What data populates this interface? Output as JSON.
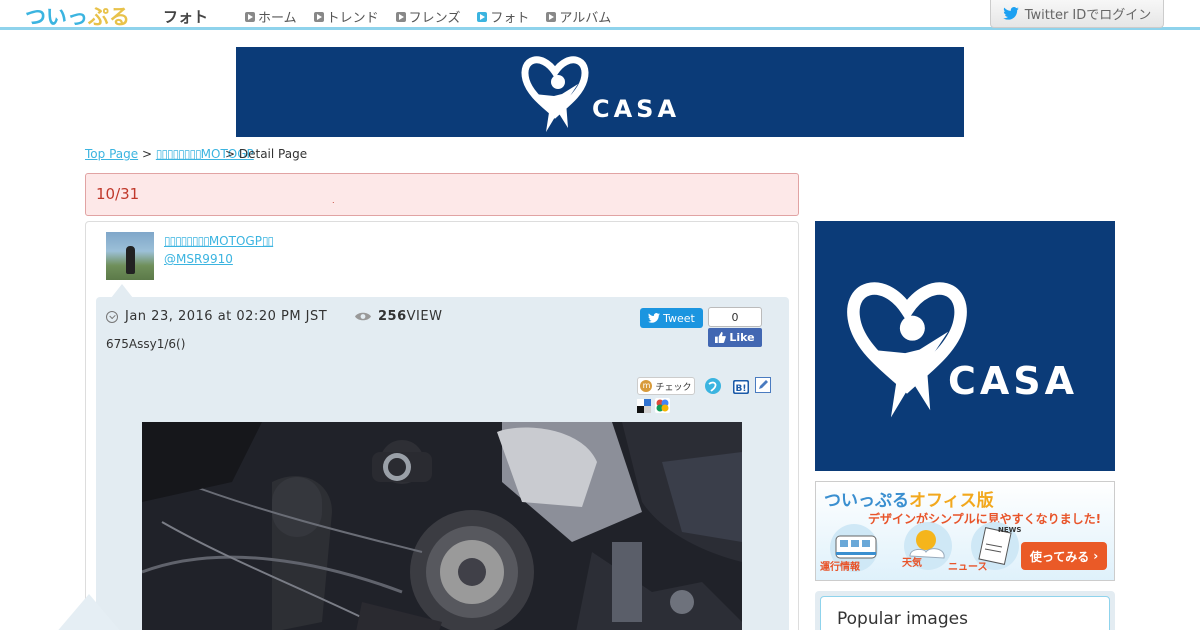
{
  "header": {
    "logo_part1": "ついっ",
    "logo_part2": "ぷる",
    "section_title": "フォト",
    "nav": [
      {
        "label": "ホーム"
      },
      {
        "label": "トレンド"
      },
      {
        "label": "フレンズ"
      },
      {
        "label": "フォト"
      },
      {
        "label": "アルバム"
      }
    ],
    "login_label": "Twitter IDでログイン"
  },
  "ads": {
    "casa_label": "CASA"
  },
  "breadcrumb": {
    "home": "Top Page",
    "user": "MOTOGP",
    "sep": ">",
    "current": "> Detail Page"
  },
  "alert": {
    "text": "10/31",
    "dot": "."
  },
  "post": {
    "user_name": "MOTOGP",
    "user_handle": "@MSR9910",
    "date": "Jan 23, 2016 at 02:20 PM JST",
    "views": "256",
    "views_suffix": "VIEW",
    "caption": "675Assy1/6()",
    "tweet_label": "Tweet",
    "like_count": "0",
    "like_label": "Like",
    "check_label": "チェック",
    "check_mark": "m"
  },
  "sidebar": {
    "office_title_1": "ついっぷる",
    "office_title_2": "オフィス版",
    "office_sub": "デザインがシンプルに見やすくなりました!",
    "office_labels": [
      "運行情報",
      "天気",
      "ニュース",
      "NEWS"
    ],
    "try_label": "使ってみる",
    "popular_title": "Popular images"
  },
  "colors": {
    "accent": "#3bb4e0",
    "ad_blue": "#0b3b78",
    "alert_bg": "#fde8e8",
    "alert_text": "#c0392b",
    "twitter": "#1b95e0",
    "facebook": "#4267b2"
  }
}
